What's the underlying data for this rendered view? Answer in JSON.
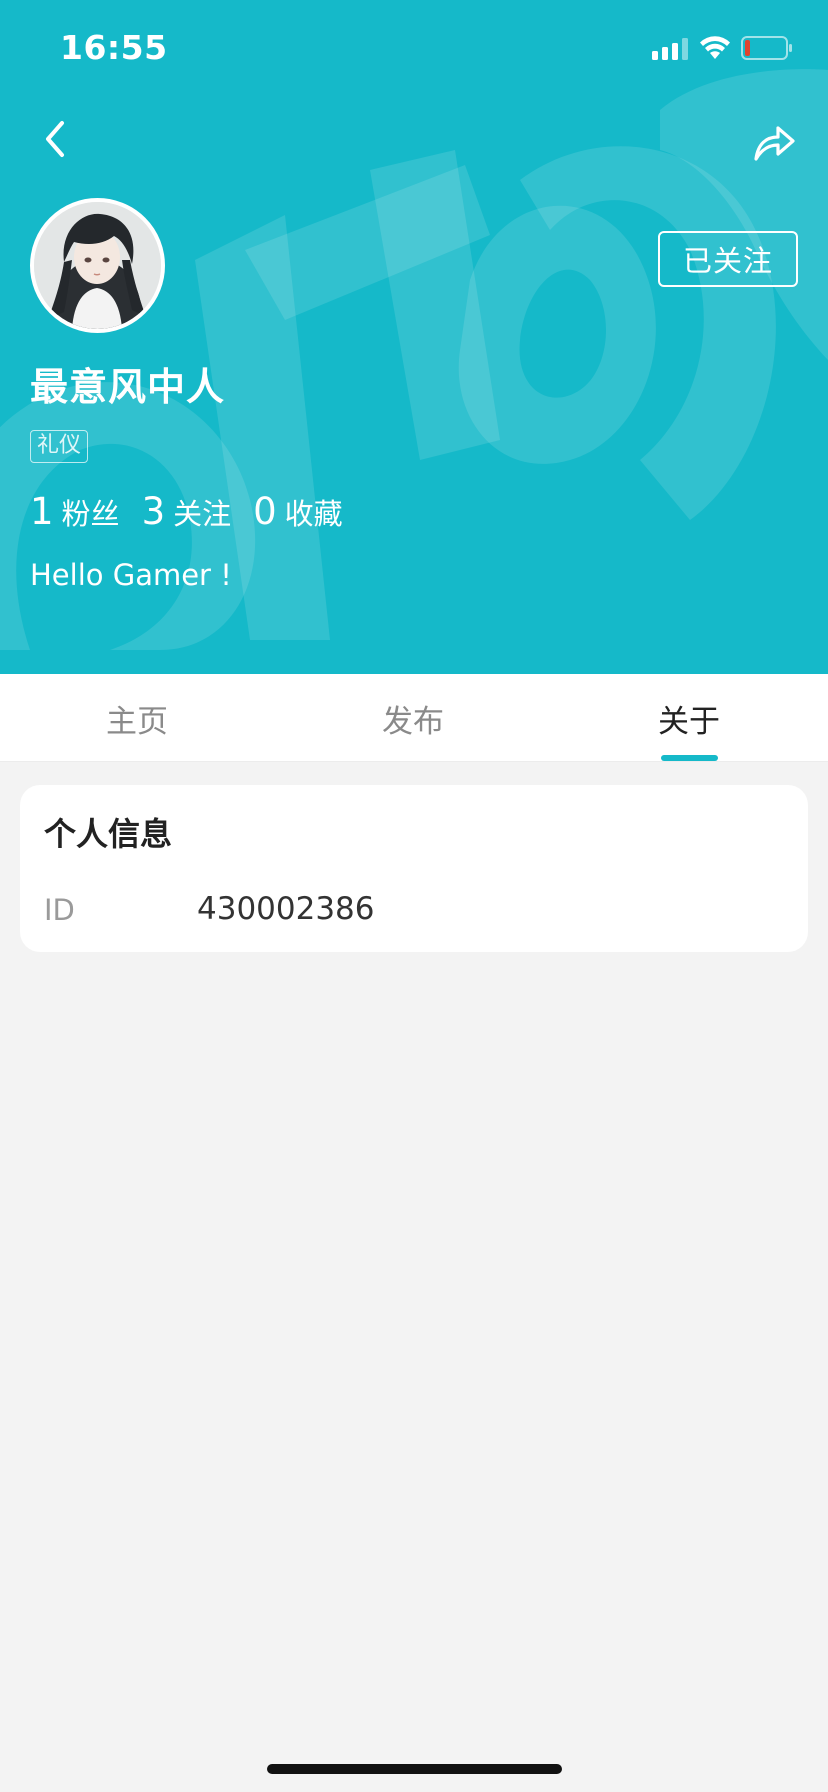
{
  "status_bar": {
    "time": "16:55",
    "signal_icon": "cellular-signal-icon",
    "wifi_icon": "wifi-icon",
    "battery_icon": "battery-low-icon"
  },
  "nav": {
    "back_icon": "chevron-left-icon",
    "share_icon": "share-arrow-icon"
  },
  "profile": {
    "avatar_description_icon": "avatar-illustration",
    "follow_button_label": "已关注",
    "username": "最意风中人",
    "tag": "礼仪",
    "stats": [
      {
        "value": "1",
        "label": "粉丝"
      },
      {
        "value": "3",
        "label": "关注"
      },
      {
        "value": "0",
        "label": "收藏"
      }
    ],
    "bio": "Hello Gamer !"
  },
  "tabs": [
    {
      "label": "主页",
      "active": false
    },
    {
      "label": "发布",
      "active": false
    },
    {
      "label": "关于",
      "active": true
    }
  ],
  "info_card": {
    "title": "个人信息",
    "rows": [
      {
        "label": "ID",
        "value": "430002386"
      }
    ]
  },
  "colors": {
    "accent": "#15b9c9",
    "background": "#f3f3f3",
    "card": "#ffffff",
    "text_primary": "#222222",
    "text_muted": "#8a8a8a"
  }
}
